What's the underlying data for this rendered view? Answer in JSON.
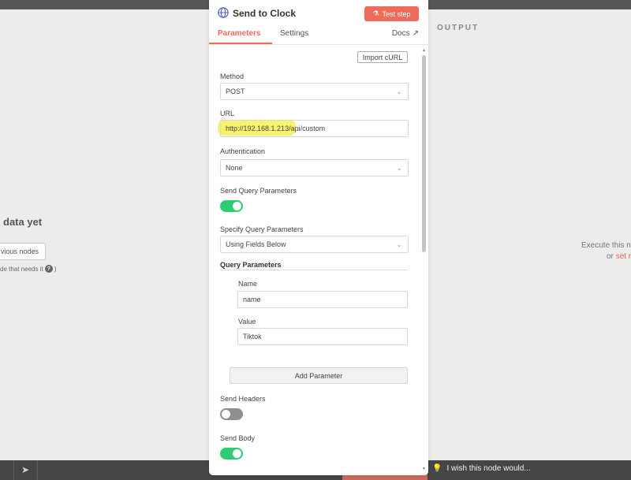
{
  "left_panel": {
    "no_data_text": "data yet",
    "previous_nodes_button": "vious nodes",
    "hint_text": "de that needs it",
    "hint_close": ")"
  },
  "output_panel": {
    "title": "OUTPUT",
    "execute_text": "Execute this n",
    "or_text": "or",
    "set_link": "set r"
  },
  "node_panel": {
    "title": "Send to Clock",
    "test_button": "Test step",
    "tabs": [
      {
        "label": "Parameters",
        "active": true
      },
      {
        "label": "Settings",
        "active": false
      }
    ],
    "docs_label": "Docs",
    "import_curl": "Import cURL",
    "method": {
      "label": "Method",
      "value": "POST"
    },
    "url": {
      "label": "URL",
      "value": "http://192.168.1.213/api/custom"
    },
    "authentication": {
      "label": "Authentication",
      "value": "None"
    },
    "send_query": {
      "label": "Send Query Parameters",
      "enabled": true
    },
    "specify_query": {
      "label": "Specify Query Parameters",
      "value": "Using Fields Below"
    },
    "query_parameters": {
      "title": "Query Parameters",
      "name_label": "Name",
      "name_value": "name",
      "value_label": "Value",
      "value_value": "Tiktok",
      "add_button": "Add Parameter"
    },
    "send_headers": {
      "label": "Send Headers",
      "enabled": false
    },
    "send_body": {
      "label": "Send Body",
      "enabled": true
    }
  },
  "bottom_bar": {
    "wish_button": "I wish this node would..."
  },
  "colors": {
    "accent": "#ef6c5a",
    "toggle_on": "#2ecc71",
    "toggle_off": "#8f8f8f",
    "highlight": "#f7f25e"
  },
  "icons": [
    "globe-icon",
    "flask-icon",
    "external-link-icon",
    "chevron-down-icon",
    "question-icon",
    "lightbulb-icon",
    "cursor-icon"
  ]
}
